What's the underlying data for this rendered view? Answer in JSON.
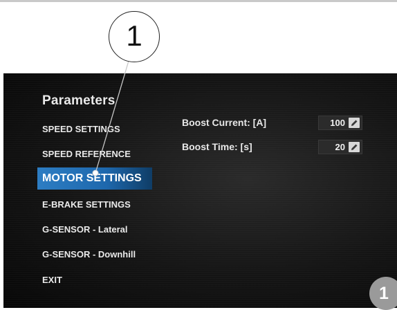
{
  "callout": {
    "number": "1"
  },
  "badge": {
    "number": "1"
  },
  "panel": {
    "title": "Parameters",
    "menu": [
      {
        "label": "SPEED SETTINGS"
      },
      {
        "label": "SPEED REFERENCE"
      },
      {
        "label": "MOTOR SETTINGS",
        "active": true
      },
      {
        "label": "E-BRAKE SETTINGS"
      },
      {
        "label": "G-SENSOR - Lateral"
      },
      {
        "label": "G-SENSOR - Downhill"
      },
      {
        "label": "EXIT"
      }
    ],
    "params": [
      {
        "label": "Boost Current: [A]",
        "value": "100",
        "icon": "pencil-icon"
      },
      {
        "label": "Boost Time: [s]",
        "value": "20",
        "icon": "pencil-icon"
      }
    ]
  },
  "colors": {
    "accent": "#1e68ad",
    "screen_bg": "#141414",
    "text": "#eaeaea"
  }
}
